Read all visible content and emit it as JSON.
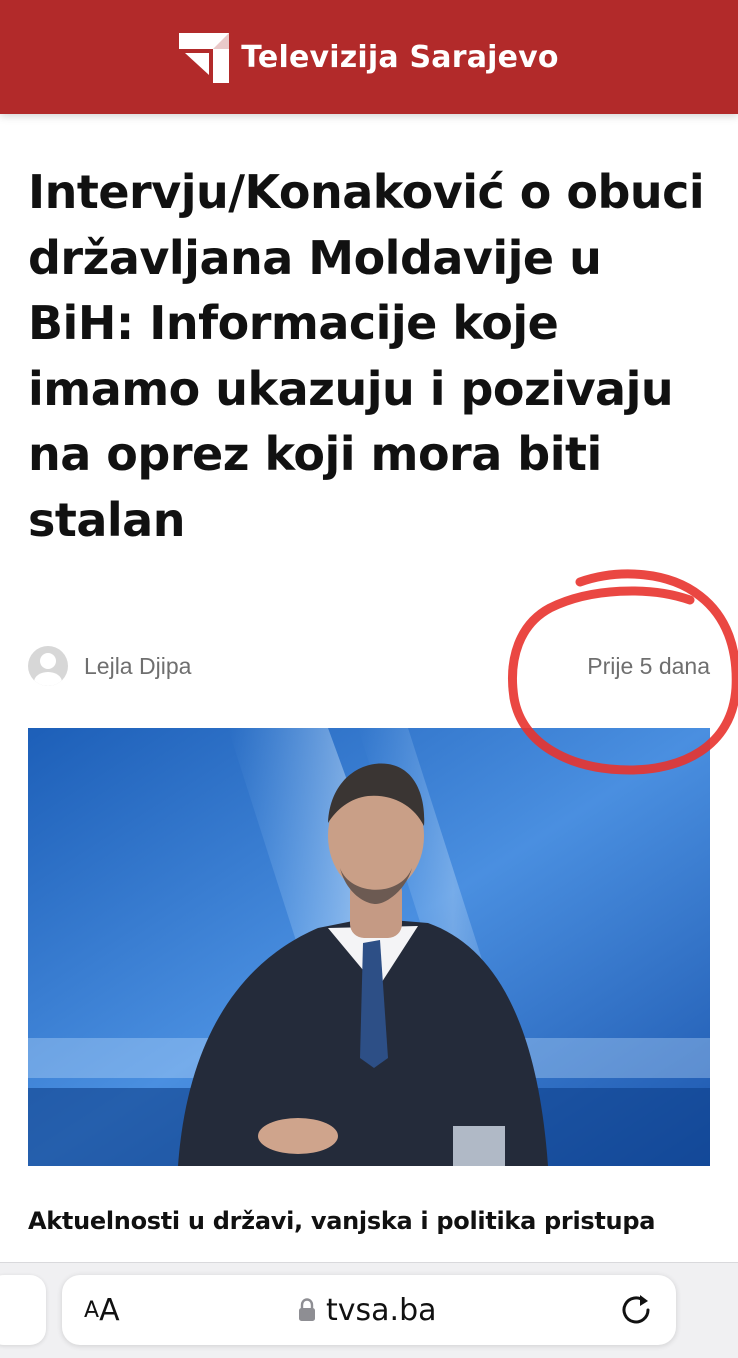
{
  "header": {
    "brand_name": "Televizija Sarajevo",
    "background_color": "#b22a2a",
    "logo_icon": "tvsa-logo-icon"
  },
  "article": {
    "title": "Intervju/Konaković o obuci državljana Moldavije u BiH: Informacije koje imamo ukazuju i pozivaju na oprez koji mora biti stalan",
    "author": "Lejla Djipa",
    "published": "Prije 5 dana",
    "lead_visible": "Aktuelnosti u državi,  vanjska i politika pristupa",
    "annotation_color": "#e8332d"
  },
  "browser": {
    "aa_small": "A",
    "aa_big": "A",
    "url": "tvsa.ba",
    "lock_icon": "lock-icon",
    "reload_icon": "reload-icon"
  }
}
